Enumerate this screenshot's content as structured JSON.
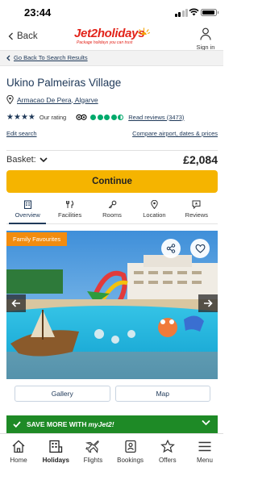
{
  "status_bar": {
    "time": "23:44"
  },
  "header": {
    "back_label": "Back",
    "logo_text": "Jet2holidays",
    "logo_tagline": "Package holidays you can trust",
    "signin_label": "Sign in"
  },
  "breadcrumb": {
    "label": "Go Back To Search Results"
  },
  "hotel": {
    "name": "Ukino Palmeiras Village",
    "location": "Armacao De Pera, Algarve",
    "our_rating_label": "Our rating",
    "star_count": 4,
    "tripadvisor_bubbles": 4.5,
    "reviews_label": "Read reviews (3473)"
  },
  "links": {
    "edit_search": "Edit search",
    "compare": "Compare airport, dates & prices"
  },
  "basket": {
    "label": "Basket:",
    "price": "£2,084"
  },
  "continue_label": "Continue",
  "tabs": [
    {
      "label": "Overview",
      "icon": "hotel-icon",
      "active": true
    },
    {
      "label": "Facilities",
      "icon": "facilities-icon"
    },
    {
      "label": "Rooms",
      "icon": "key-icon"
    },
    {
      "label": "Location",
      "icon": "location-pin-icon"
    },
    {
      "label": "Reviews",
      "icon": "reviews-icon"
    }
  ],
  "hero": {
    "badge": "Family Favourites"
  },
  "gallery_label": "Gallery",
  "map_label": "Map",
  "myjet": {
    "prefix": "SAVE MORE WITH ",
    "brand": "myJet2!"
  },
  "bottom_nav": [
    {
      "label": "Home",
      "icon": "home-icon"
    },
    {
      "label": "Holidays",
      "icon": "holidays-icon",
      "active": true
    },
    {
      "label": "Flights",
      "icon": "plane-icon"
    },
    {
      "label": "Bookings",
      "icon": "bookings-icon"
    },
    {
      "label": "Offers",
      "icon": "star-icon"
    },
    {
      "label": "Menu",
      "icon": "menu-icon"
    }
  ],
  "colors": {
    "brand_red": "#e2231a",
    "navy": "#203a5a",
    "cta_yellow": "#f5b400",
    "badge_orange": "#f28c0f",
    "myjet_green": "#1e8a26",
    "tripadvisor_green": "#00aa6c"
  }
}
